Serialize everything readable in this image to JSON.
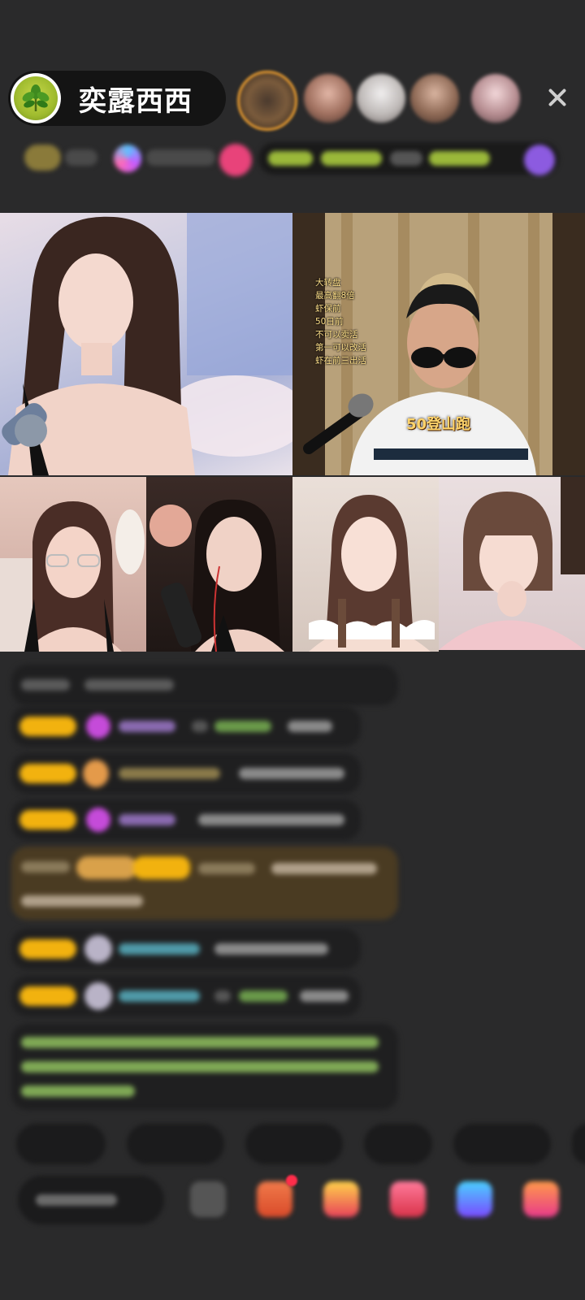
{
  "host": {
    "name": "奕露西西",
    "avatar_icon": "plant-icon"
  },
  "viewers": [
    {
      "name": "viewer-1",
      "color": "#6b4a2a"
    },
    {
      "name": "viewer-2",
      "color": "#b27a6a"
    },
    {
      "name": "viewer-3",
      "color": "#d8d2cf"
    },
    {
      "name": "viewer-4",
      "color": "#9b7a67"
    },
    {
      "name": "viewer-5",
      "color": "#c7a6a9"
    }
  ],
  "close_icon": "close-icon",
  "video": {
    "overlay_lines": [
      "大转盘",
      "最高翻8倍",
      "虾保前",
      "50日前",
      "不可以卖活",
      "第一可以改活",
      "虾在前三出活"
    ],
    "mountain_tag": "50登山跑"
  },
  "colors": {
    "background": "#2a2a2b",
    "level_badge": "#f2b20f",
    "gift_heart": "#c54bd9",
    "chat_green": "#a4d36b",
    "chat_cyan": "#5bb7c7"
  }
}
